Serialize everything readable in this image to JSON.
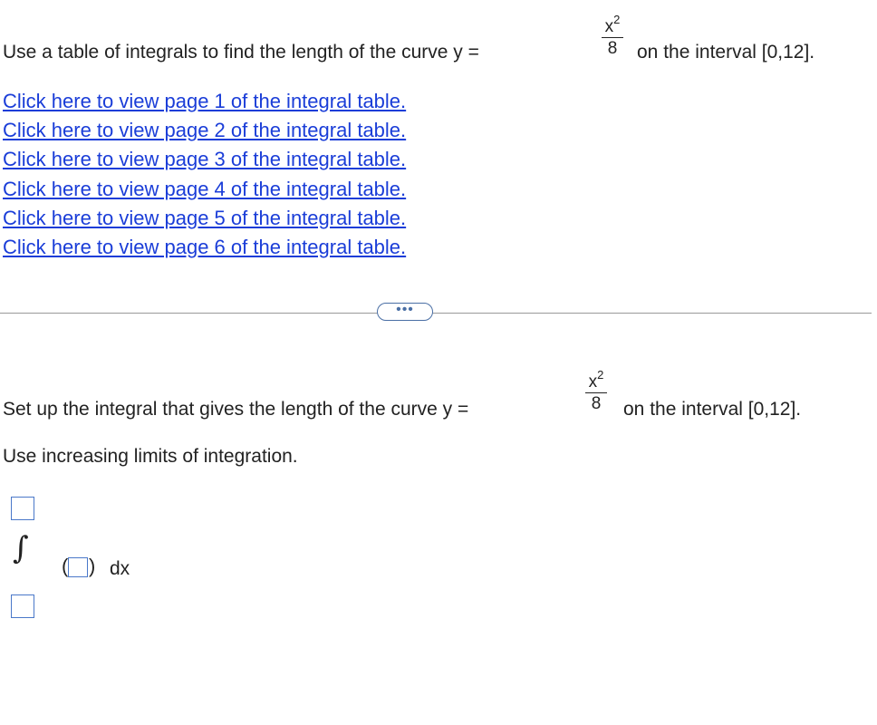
{
  "question": {
    "prefix": "Use a table of integrals to find the length of the curve y =",
    "numerator": "x",
    "exponent": "2",
    "denominator": "8",
    "suffix": "on the interval [0,12]."
  },
  "links": [
    "Click here to view page 1 of the integral table.",
    "Click here to view page 2 of the integral table.",
    "Click here to view page 3 of the integral table.",
    "Click here to view page 4 of the integral table.",
    "Click here to view page 5 of the integral table.",
    "Click here to view page 6 of the integral table."
  ],
  "more_button": "•••",
  "part": {
    "prefix": "Set up the integral that gives the length of the curve y =",
    "numerator": "x",
    "exponent": "2",
    "denominator": "8",
    "suffix": "on the interval [0,12].",
    "instruction": "Use increasing limits of integration."
  },
  "integral": {
    "sign": "∫",
    "open_paren": "(",
    "close_paren": ")",
    "differential": "dx"
  },
  "colors": {
    "link": "#1a3dd8",
    "input_border": "#4a78c9"
  }
}
